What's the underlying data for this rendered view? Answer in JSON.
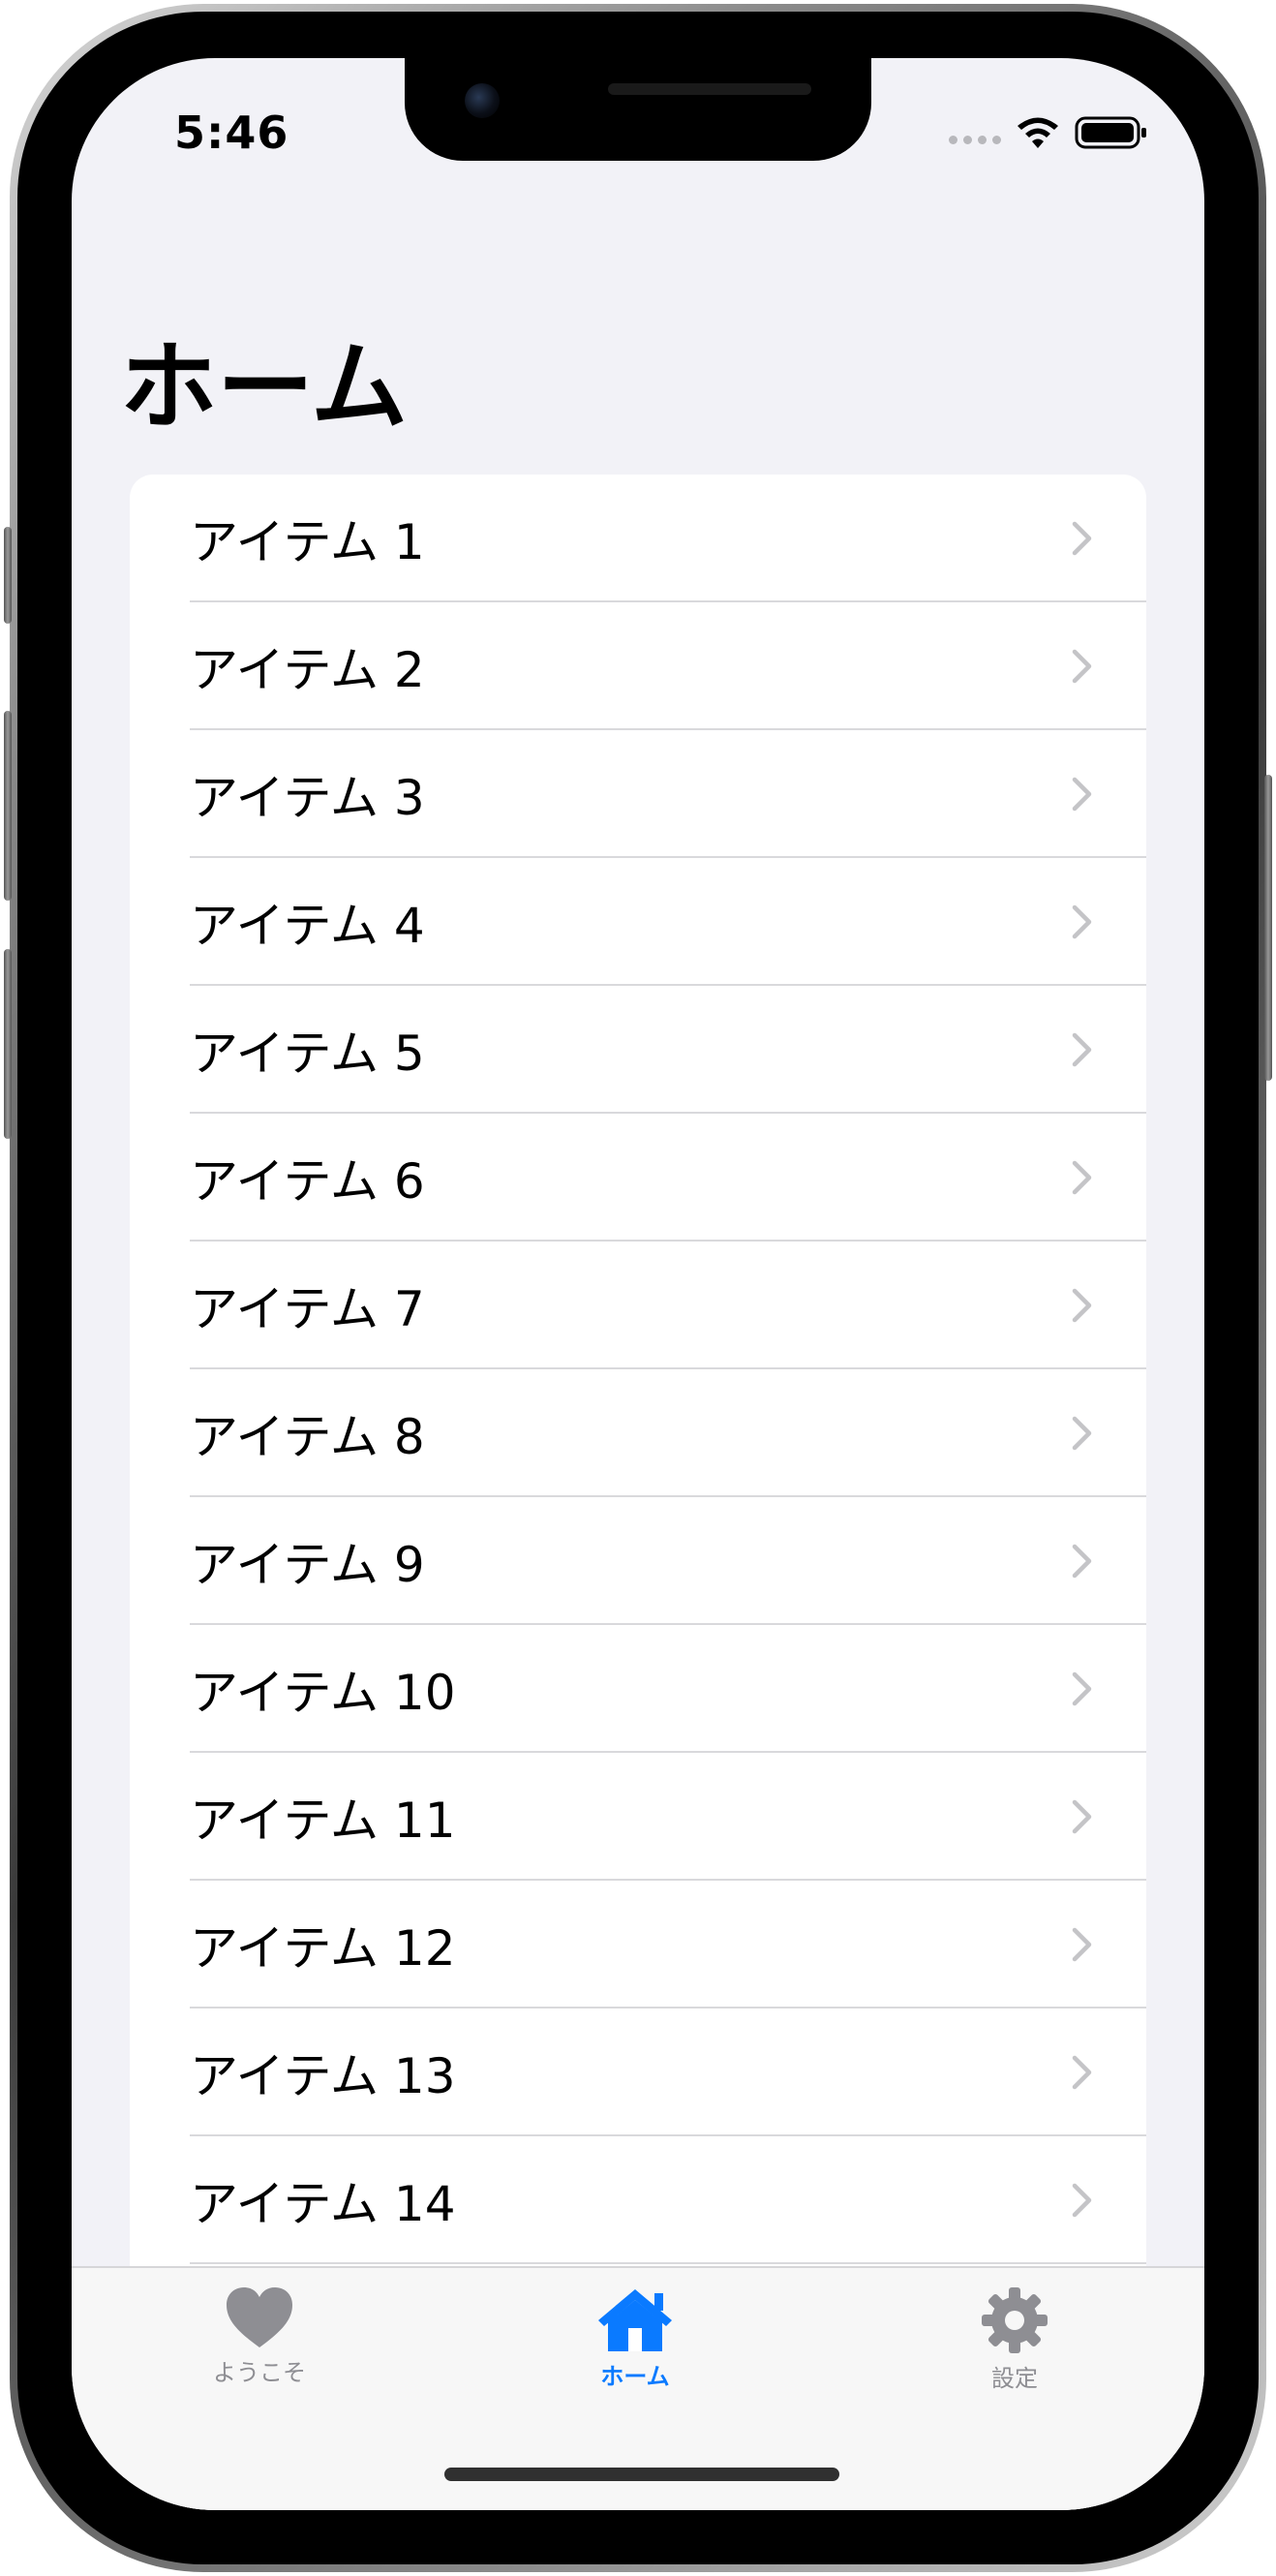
{
  "status_bar": {
    "time": "5:46",
    "wifi_icon": "wifi-icon",
    "battery_icon": "battery-icon"
  },
  "navigation": {
    "title": "ホーム"
  },
  "list": {
    "items": [
      {
        "label": "アイテム 1"
      },
      {
        "label": "アイテム 2"
      },
      {
        "label": "アイテム 3"
      },
      {
        "label": "アイテム 4"
      },
      {
        "label": "アイテム 5"
      },
      {
        "label": "アイテム 6"
      },
      {
        "label": "アイテム 7"
      },
      {
        "label": "アイテム 8"
      },
      {
        "label": "アイテム 9"
      },
      {
        "label": "アイテム 10"
      },
      {
        "label": "アイテム 11"
      },
      {
        "label": "アイテム 12"
      },
      {
        "label": "アイテム 13"
      },
      {
        "label": "アイテム 14"
      }
    ],
    "chevron_icon": "chevron-right-icon"
  },
  "tab_bar": {
    "tabs": [
      {
        "label": "ようこそ",
        "icon": "heart-icon",
        "selected": false
      },
      {
        "label": "ホーム",
        "icon": "house-icon",
        "selected": true
      },
      {
        "label": "設定",
        "icon": "gear-icon",
        "selected": false
      }
    ]
  },
  "colors": {
    "accent": "#0a7aff",
    "inactive": "#8e8e93",
    "background": "#f2f2f7",
    "card": "#ffffff",
    "separator": "#d9d9dc"
  }
}
